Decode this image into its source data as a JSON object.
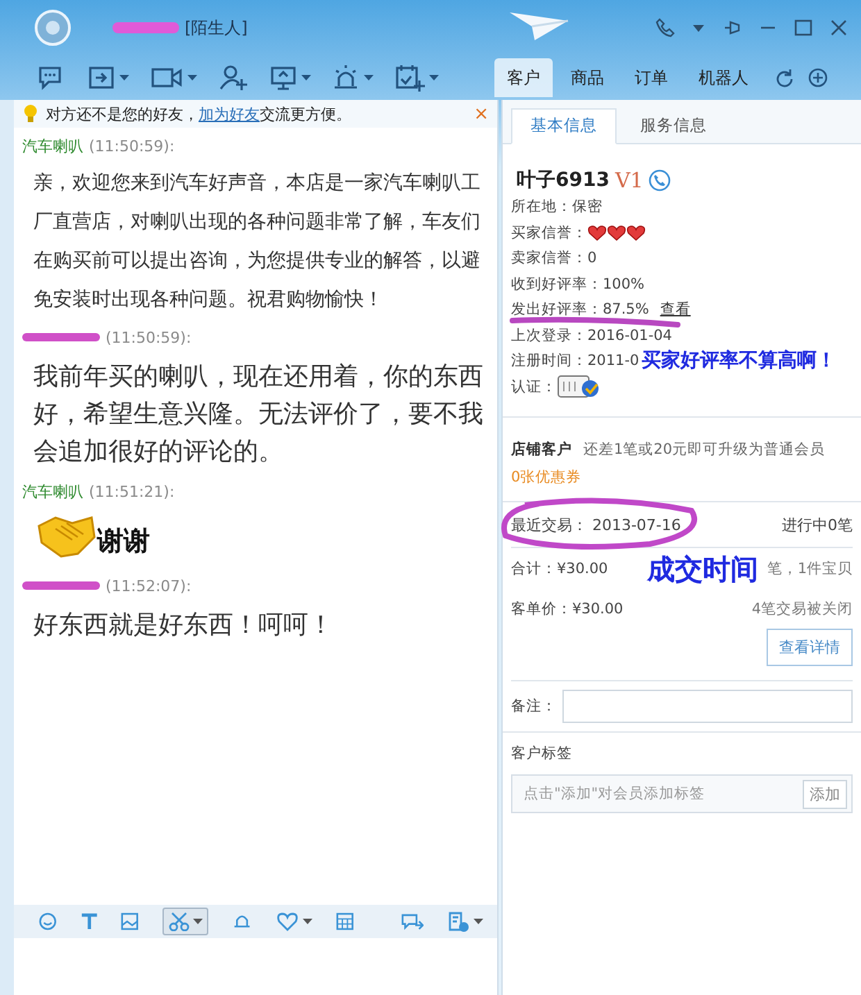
{
  "window": {
    "tag": "[陌生人]"
  },
  "customer_tabs": [
    {
      "label": "客户",
      "selected": true
    },
    {
      "label": "商品",
      "selected": false
    },
    {
      "label": "订单",
      "selected": false
    },
    {
      "label": "机器人",
      "selected": false
    }
  ],
  "notice": {
    "before": "对方还不是您的好友，",
    "link": "加为好友",
    "after": "交流更方便。",
    "close": "×"
  },
  "messages": [
    {
      "kind": "shop",
      "sender": "汽车喇叭",
      "time": "(11:50:59):",
      "text": "亲，欢迎您来到汽车好声音，本店是一家汽车喇叭工厂直营店，对喇叭出现的各种问题非常了解，车友们在购买前可以提出咨询，为您提供专业的解答，以避免安装时出现各种问题。祝君购物愉快！"
    },
    {
      "kind": "customer",
      "time": "(11:50:59):",
      "text": "我前年买的喇叭，现在还用着，你的东西好，希望生意兴隆。无法评价了，要不我会追加很好的评论的。"
    },
    {
      "kind": "emote",
      "sender": "汽车喇叭",
      "time": "(11:51:21):",
      "text": "谢谢"
    },
    {
      "kind": "customer",
      "time": "(11:52:07):",
      "text": "好东西就是好东西！呵呵！"
    }
  ],
  "info_tabs": [
    {
      "label": "基本信息",
      "selected": true
    },
    {
      "label": "服务信息",
      "selected": false
    }
  ],
  "profile": {
    "name": "叶子6913",
    "level": "V1",
    "fields": [
      {
        "kind": "text",
        "text": "所在地：保密"
      },
      {
        "kind": "hearts",
        "text": "买家信誉：",
        "stars": 3
      },
      {
        "kind": "text",
        "text": "卖家信誉：0"
      },
      {
        "kind": "text",
        "text": "收到好评率：100%"
      },
      {
        "kind": "link",
        "text": "发出好评率：87.5%",
        "link": "查看"
      },
      {
        "kind": "text",
        "text": "上次登录：2016-01-04"
      },
      {
        "kind": "text",
        "text": "注册时间：2011-0"
      },
      {
        "kind": "badge",
        "text": "认证："
      }
    ],
    "annotation": "买家好评率不算高啊！"
  },
  "shop": {
    "label": "店铺客户",
    "hint": "还差1笔或20元即可升级为普通会员",
    "coupon": "0张优惠券"
  },
  "trade": {
    "recent": "最近交易：  2013-07-16",
    "ongoing": "进行中0笔",
    "total": "合计：¥30.00",
    "total_note": "笔，1件宝贝",
    "unit_price": "客单价：¥30.00",
    "closed": "4笔交易被关闭",
    "details_button": "查看详情",
    "annotation": "成交时间"
  },
  "note": {
    "label": "备注："
  },
  "tags": {
    "title": "客户标签",
    "placeholder": "点击\"添加\"对会员添加标签",
    "add_button": "添加"
  }
}
